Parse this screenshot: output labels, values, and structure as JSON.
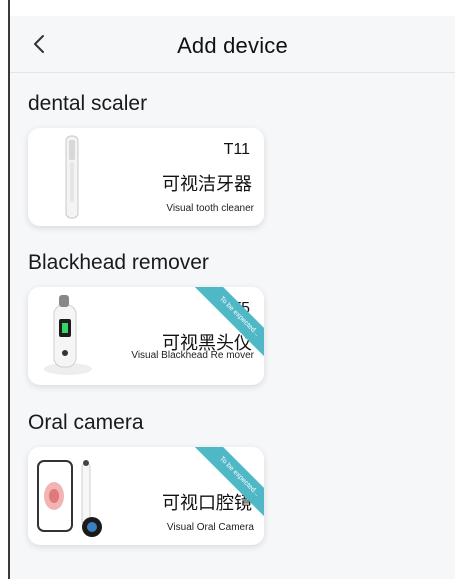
{
  "header": {
    "title": "Add device",
    "back_icon": "chevron-left-icon"
  },
  "sections": [
    {
      "title": "dental scaler",
      "device": {
        "model": "T11",
        "name_cn": "可视洁牙器",
        "name_en": "Visual tooth cleaner",
        "ribbon": ""
      }
    },
    {
      "title": "Blackhead remover",
      "device": {
        "model": "T5",
        "name_cn": "可视黑头仪",
        "name_en": "Visual Blackhead Re mover",
        "ribbon": "To be expected..."
      }
    },
    {
      "title": "Oral camera",
      "device": {
        "model": "",
        "name_cn": "可视口腔镜",
        "name_en": "Visual Oral Camera",
        "ribbon": "To be expected..."
      }
    }
  ],
  "colors": {
    "ribbon": "#4fb7c6",
    "background": "#f6f7f9"
  }
}
